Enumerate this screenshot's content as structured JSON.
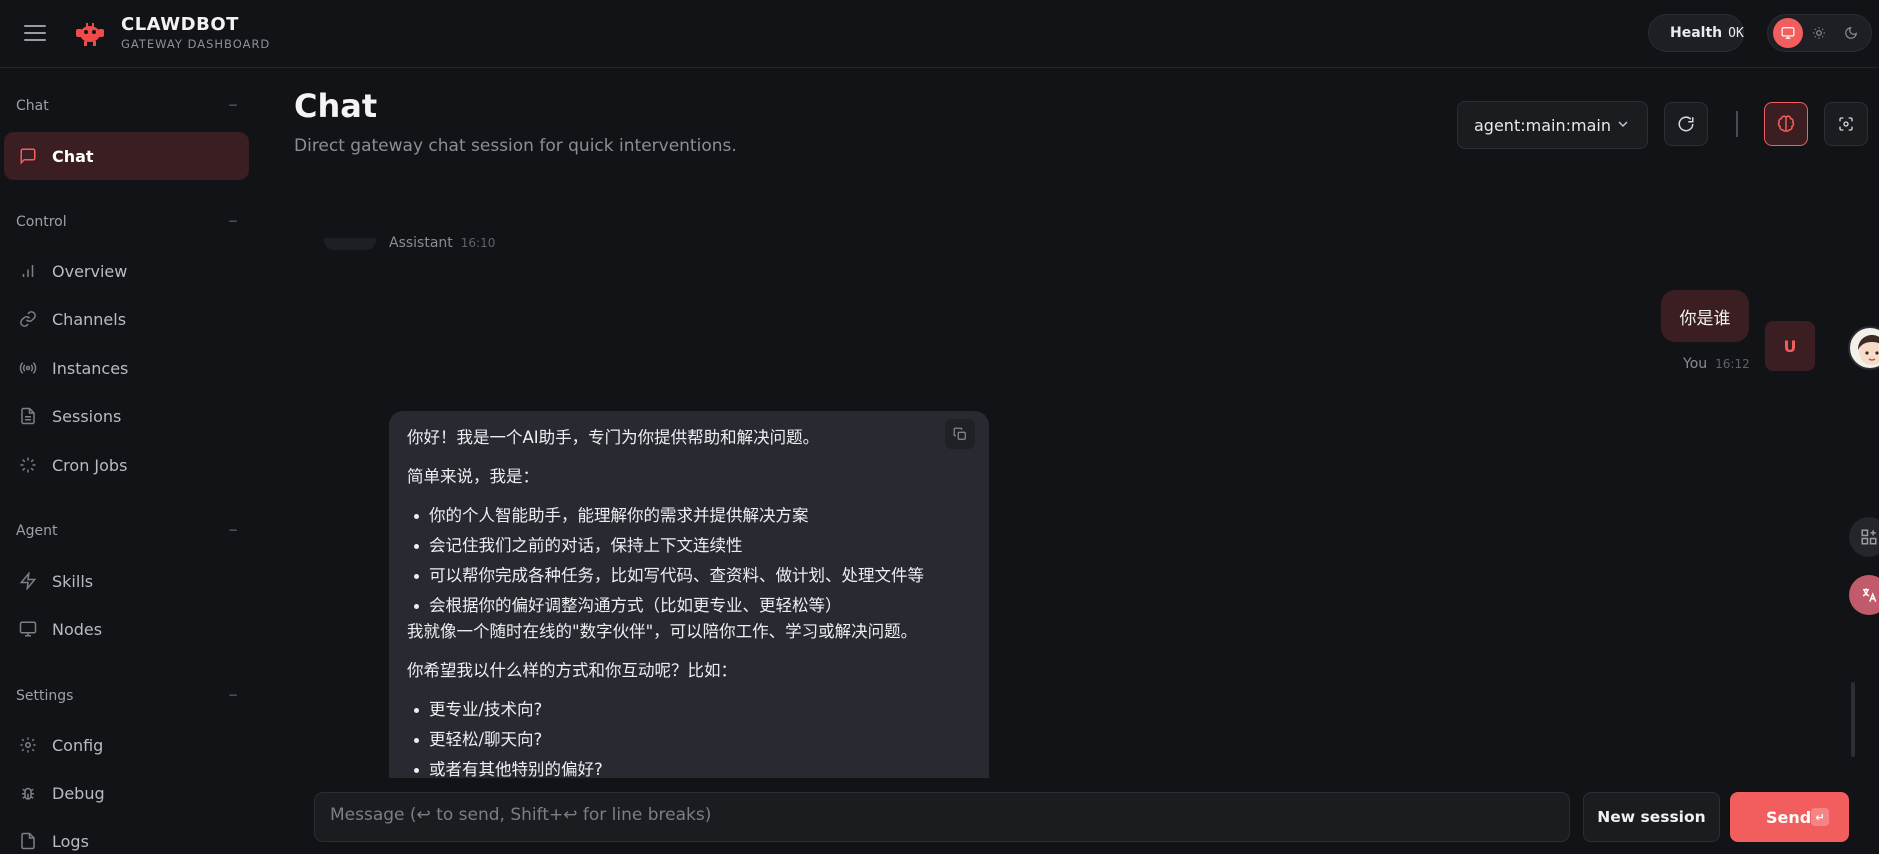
{
  "brand": {
    "name": "CLAWDBOT",
    "subtitle": "GATEWAY DASHBOARD"
  },
  "health": {
    "label": "Health",
    "value": "OK",
    "status_color": "#22c55e"
  },
  "theme": {
    "modes": [
      "system",
      "light",
      "dark"
    ],
    "active": "system"
  },
  "colors": {
    "accent": "#f25e5e",
    "accent_bg": "#3a1e21",
    "background": "#121316",
    "surface": "#1a1c20"
  },
  "sidebar": {
    "sections": {
      "chat": {
        "label": "Chat",
        "collapse": "−"
      },
      "control": {
        "label": "Control",
        "collapse": "−"
      },
      "agent": {
        "label": "Agent",
        "collapse": "−"
      },
      "settings": {
        "label": "Settings",
        "collapse": "−"
      }
    },
    "items": {
      "chat": {
        "label": "Chat",
        "icon": "message-square-icon"
      },
      "overview": {
        "label": "Overview",
        "icon": "bar-chart-icon"
      },
      "channels": {
        "label": "Channels",
        "icon": "link-icon"
      },
      "instances": {
        "label": "Instances",
        "icon": "radio-icon"
      },
      "sessions": {
        "label": "Sessions",
        "icon": "file-text-icon"
      },
      "cron": {
        "label": "Cron Jobs",
        "icon": "loader-icon"
      },
      "skills": {
        "label": "Skills",
        "icon": "zap-icon"
      },
      "nodes": {
        "label": "Nodes",
        "icon": "monitor-icon"
      },
      "config": {
        "label": "Config",
        "icon": "gear-icon"
      },
      "debug": {
        "label": "Debug",
        "icon": "bug-icon"
      },
      "logs": {
        "label": "Logs",
        "icon": "file-icon"
      }
    }
  },
  "main": {
    "title": "Chat",
    "subtitle": "Direct gateway chat session for quick interventions.",
    "session_select": "agent:main:main"
  },
  "chat": {
    "prev_assistant": {
      "sender": "Assistant",
      "time": "16:10"
    },
    "user_message": {
      "text": "你是谁",
      "sender": "You",
      "time": "16:12",
      "avatar": "U"
    },
    "assistant_message": {
      "intro": "你好！我是一个AI助手，专门为你提供帮助和解决问题。",
      "lead": "简单来说，我是：",
      "points": [
        "你的个人智能助手，能理解你的需求并提供解决方案",
        "会记住我们之前的对话，保持上下文连续性",
        "可以帮你完成各种任务，比如写代码、查资料、做计划、处理文件等",
        "会根据你的偏好调整沟通方式（比如更专业、更轻松等）"
      ],
      "summary": "我就像一个随时在线的\"数字伙伴\"，可以陪你工作、学习或解决问题。",
      "question": "你希望我以什么样的方式和你互动呢？比如：",
      "options": [
        "更专业/技术向?",
        "更轻松/聊天向?",
        "或者有其他特别的偏好?"
      ]
    }
  },
  "composer": {
    "placeholder": "Message (↩ to send, Shift+↩ for line breaks)",
    "new_session_label": "New session",
    "send_label": "Send",
    "send_kbd": "↵"
  }
}
